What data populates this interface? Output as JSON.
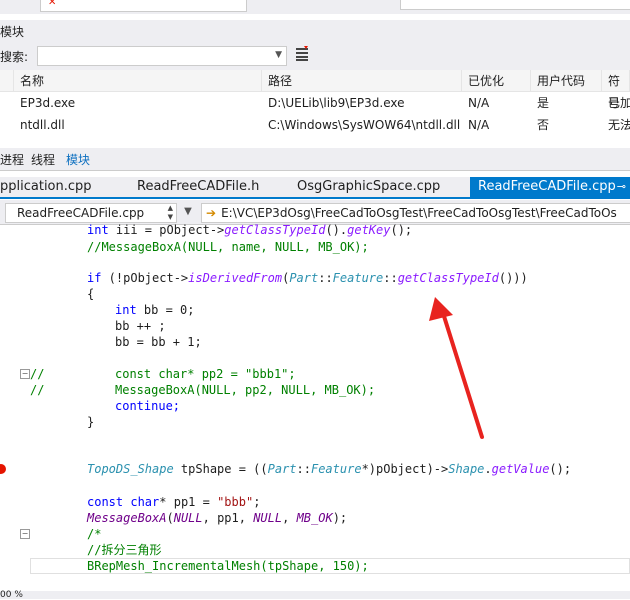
{
  "top_strip": {},
  "modules_panel": {
    "title": "模块",
    "search_label": "搜索:",
    "search_value": ""
  },
  "modules_table": {
    "columns": [
      "名称",
      "路径",
      "已优化",
      "用户代码",
      "符号"
    ],
    "rows": [
      {
        "name": "EP3d.exe",
        "path": "D:\\UELib\\lib9\\EP3d.exe",
        "optimized": "N/A",
        "user_code": "是",
        "symbols": "已加"
      },
      {
        "name": "ntdll.dll",
        "path": "C:\\Windows\\SysWOW64\\ntdll.dll",
        "optimized": "N/A",
        "user_code": "否",
        "symbols": "无法"
      }
    ]
  },
  "bottom_tabs": [
    "进程",
    "线程",
    "模块"
  ],
  "doc_tabs": [
    "pplication.cpp",
    "ReadFreeCADFile.h",
    "OsgGraphicSpace.cpp",
    "ReadFreeCADFile.cpp"
  ],
  "nav": {
    "file": "ReadFreeCADFile.cpp",
    "path": "E:\\VC\\EP3dOsg\\FreeCadToOsgTest\\FreeCadToOsgTest\\FreeCadToOs"
  },
  "code": {
    "l1_a": "int",
    "l1_b": " iii = pObject->",
    "l1_c": "getClassTypeId",
    "l1_d": "().",
    "l1_e": "getKey",
    "l1_f": "();",
    "l2": "//MessageBoxA(NULL, name, NULL, MB_OK);",
    "l4_a": "if",
    "l4_b": " (!pObject->",
    "l4_c": "isDerivedFrom",
    "l4_d": "(",
    "l4_e": "Part",
    "l4_f": "::",
    "l4_g": "Feature",
    "l4_h": "::",
    "l4_i": "getClassTypeId",
    "l4_j": "()))",
    "l5": "{",
    "l6_a": "int",
    "l6_b": " bb = 0;",
    "l7": "bb ++ ;",
    "l8": "bb = bb + 1;",
    "l10_a": "//",
    "l10_b": "const char* pp2 = \"bbb1\";",
    "l11_a": "//",
    "l11_b": "MessageBoxA(NULL, pp2, NULL, MB_OK);",
    "l12": "continue;",
    "l13": "}",
    "l16_a": "TopoDS_Shape",
    "l16_b": " tpShape = ((",
    "l16_c": "Part",
    "l16_d": "::",
    "l16_e": "Feature",
    "l16_f": "*)pObject)->",
    "l16_g": "Shape",
    "l16_h": ".",
    "l16_i": "getValue",
    "l16_j": "();",
    "l18_a": "const",
    "l18_b": "char",
    "l18_c": "* pp1 = ",
    "l18_d": "\"bbb\"",
    "l18_e": ";",
    "l19_a": "MessageBoxA",
    "l19_b": "(",
    "l19_c": "NULL",
    "l19_d": ", pp1, ",
    "l19_e": "NULL",
    "l19_f": ", ",
    "l19_g": "MB_OK",
    "l19_h": ");",
    "l20": "/*",
    "l21": "//拆分三角形",
    "l22": "BRepMesh_IncrementalMesh(tpShape, 150);"
  },
  "status": {
    "zoom": "00 %"
  },
  "colors": {
    "accent": "#007acc",
    "arrow": "#e8231f",
    "breakpoint": "#e51400"
  }
}
